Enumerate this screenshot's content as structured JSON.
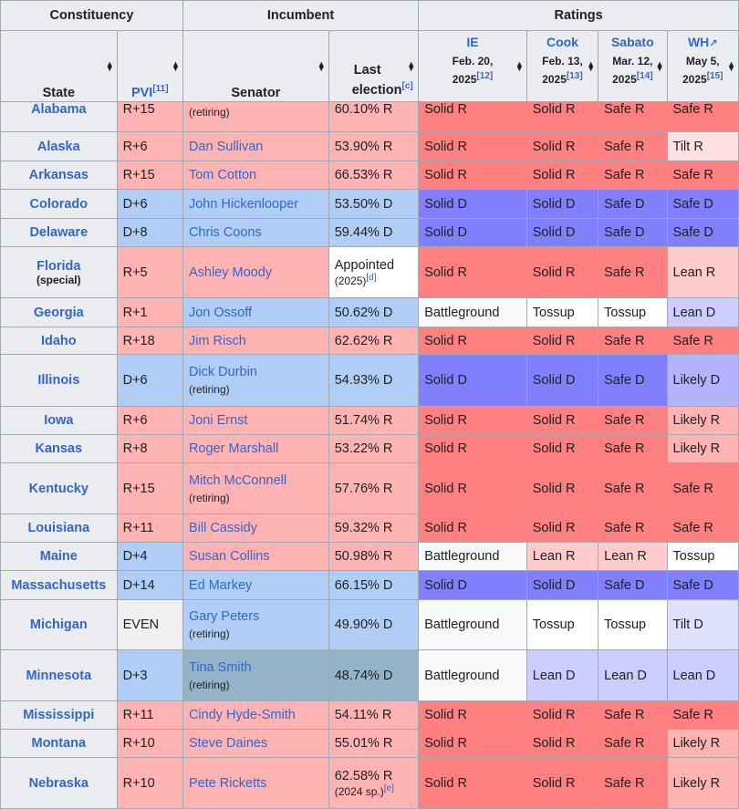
{
  "headers": {
    "constituency": "Constituency",
    "incumbent": "Incumbent",
    "ratings": "Ratings",
    "state": "State",
    "pvi": "PVI",
    "pvi_ref": "[11]",
    "senator": "Senator",
    "last": "Last",
    "election": "election",
    "election_ref": "[c]",
    "sources": [
      {
        "name": "IE",
        "date1": "Feb. 20,",
        "date2": "2025",
        "ref": "[12]"
      },
      {
        "name": "Cook",
        "date1": "Feb. 13,",
        "date2": "2025",
        "ref": "[13]"
      },
      {
        "name": "Sabato",
        "date1": "Mar. 12,",
        "date2": "2025",
        "ref": "[14]"
      },
      {
        "name": "WH",
        "date1": "May 5,",
        "date2": "2025",
        "ref": "[15]"
      }
    ]
  },
  "rows": [
    {
      "state": "Alabama",
      "pvi": "R+15",
      "senator": "",
      "note": "(retiring)",
      "last": "60.10% R",
      "ratings": [
        "Solid R",
        "Solid R",
        "Safe R",
        "Safe R"
      ]
    },
    {
      "state": "Alaska",
      "pvi": "R+6",
      "senator": "Dan Sullivan",
      "last": "53.90% R",
      "ratings": [
        "Solid R",
        "Solid R",
        "Safe R",
        "Tilt R"
      ]
    },
    {
      "state": "Arkansas",
      "pvi": "R+15",
      "senator": "Tom Cotton",
      "last": "66.53% R",
      "ratings": [
        "Solid R",
        "Solid R",
        "Safe R",
        "Safe R"
      ]
    },
    {
      "state": "Colorado",
      "pvi": "D+6",
      "senator": "John Hickenlooper",
      "last": "53.50% D",
      "ratings": [
        "Solid D",
        "Solid D",
        "Safe D",
        "Safe D"
      ]
    },
    {
      "state": "Delaware",
      "pvi": "D+8",
      "senator": "Chris Coons",
      "last": "59.44% D",
      "ratings": [
        "Solid D",
        "Solid D",
        "Safe D",
        "Safe D"
      ]
    },
    {
      "state": "Florida",
      "state_sub": "(special)",
      "pvi": "R+5",
      "senator": "Ashley Moody",
      "last": "Appointed",
      "last_sub": "(2025)",
      "last_ref": "[d]",
      "ratings": [
        "Solid R",
        "Solid R",
        "Safe R",
        "Lean R"
      ]
    },
    {
      "state": "Georgia",
      "pvi": "R+1",
      "senator": "Jon Ossoff",
      "last": "50.62% D",
      "ratings": [
        "Battleground",
        "Tossup",
        "Tossup",
        "Lean D"
      ]
    },
    {
      "state": "Idaho",
      "pvi": "R+18",
      "senator": "Jim Risch",
      "last": "62.62% R",
      "ratings": [
        "Solid R",
        "Solid R",
        "Safe R",
        "Safe R"
      ]
    },
    {
      "state": "Illinois",
      "pvi": "D+6",
      "senator": "Dick Durbin",
      "note": "(retiring)",
      "last": "54.93% D",
      "ratings": [
        "Solid D",
        "Solid D",
        "Safe D",
        "Likely D"
      ]
    },
    {
      "state": "Iowa",
      "pvi": "R+6",
      "senator": "Joni Ernst",
      "last": "51.74% R",
      "ratings": [
        "Solid R",
        "Solid R",
        "Safe R",
        "Likely R"
      ]
    },
    {
      "state": "Kansas",
      "pvi": "R+8",
      "senator": "Roger Marshall",
      "last": "53.22% R",
      "ratings": [
        "Solid R",
        "Solid R",
        "Safe R",
        "Likely R"
      ]
    },
    {
      "state": "Kentucky",
      "pvi": "R+15",
      "senator": "Mitch McConnell",
      "note": "(retiring)",
      "last": "57.76% R",
      "ratings": [
        "Solid R",
        "Solid R",
        "Safe R",
        "Safe R"
      ]
    },
    {
      "state": "Louisiana",
      "pvi": "R+11",
      "senator": "Bill Cassidy",
      "last": "59.32% R",
      "ratings": [
        "Solid R",
        "Solid R",
        "Safe R",
        "Safe R"
      ]
    },
    {
      "state": "Maine",
      "pvi": "D+4",
      "senator": "Susan Collins",
      "last": "50.98% R",
      "ratings": [
        "Battleground",
        "Lean R",
        "Lean R",
        "Tossup"
      ]
    },
    {
      "state": "Massachusetts",
      "pvi": "D+14",
      "senator": "Ed Markey",
      "last": "66.15% D",
      "ratings": [
        "Solid D",
        "Solid D",
        "Safe D",
        "Safe D"
      ]
    },
    {
      "state": "Michigan",
      "pvi": "EVEN",
      "senator": "Gary Peters",
      "note": "(retiring)",
      "last": "49.90% D",
      "ratings": [
        "Battleground",
        "Tossup",
        "Tossup",
        "Tilt D"
      ]
    },
    {
      "state": "Minnesota",
      "pvi": "D+3",
      "senator": "Tina Smith",
      "note": "(retiring)",
      "last": "48.74% D",
      "ratings": [
        "Battleground",
        "Lean D",
        "Lean D",
        "Lean D"
      ]
    },
    {
      "state": "Mississippi",
      "pvi": "R+11",
      "senator": "Cindy Hyde-Smith",
      "last": "54.11% R",
      "ratings": [
        "Solid R",
        "Solid R",
        "Safe R",
        "Safe R"
      ]
    },
    {
      "state": "Montana",
      "pvi": "R+10",
      "senator": "Steve Daines",
      "last": "55.01% R",
      "ratings": [
        "Solid R",
        "Solid R",
        "Safe R",
        "Likely R"
      ]
    },
    {
      "state": "Nebraska",
      "pvi": "R+10",
      "senator": "Pete Ricketts",
      "last": "62.58% R",
      "last_sub": "(2024 sp.)",
      "last_ref": "[e]",
      "ratings": [
        "Solid R",
        "Solid R",
        "Safe R",
        "Likely R"
      ]
    }
  ],
  "colors": {
    "header_bg": "#eaecf0",
    "link": "#3366cc",
    "solid_r": "#ff8080",
    "solid_d": "#8080ff",
    "rep_incumbent": "#ffb3b3",
    "dem_incumbent": "#b0cef5",
    "dfl_incumbent": "#94b3c9"
  },
  "icons": [
    "sort-arrows-icon",
    "external-link-icon"
  ]
}
